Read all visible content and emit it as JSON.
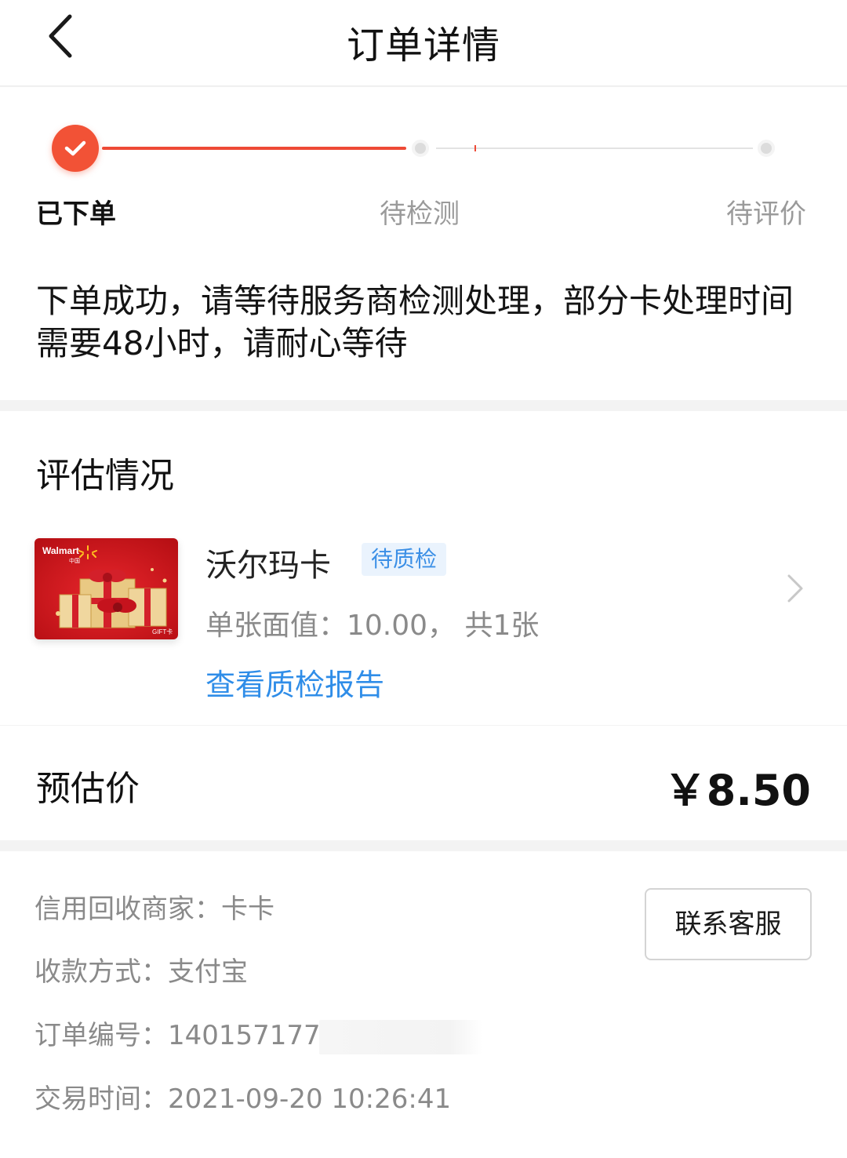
{
  "header": {
    "title": "订单详情",
    "back_icon": "chevron-left-icon"
  },
  "progress": {
    "current_step": 1,
    "steps": [
      {
        "label": "已下单",
        "state": "done"
      },
      {
        "label": "待检测",
        "state": "pending"
      },
      {
        "label": "待评价",
        "state": "pending"
      }
    ],
    "message": "下单成功，请等待服务商检测处理，部分卡处理时间需要48小时，请耐心等待"
  },
  "evaluation": {
    "title": "评估情况",
    "card": {
      "name": "沃尔玛卡",
      "status_badge": "待质检",
      "face_value_text": "单张面值：10.00， 共1张",
      "report_link": "查看质检报告",
      "image_brand_text": "Walmart",
      "image_region_text": "中国",
      "image_footer_text": "GIFT卡"
    }
  },
  "price": {
    "label": "预估价",
    "value": "￥8.50"
  },
  "info": {
    "merchant": "信用回收商家：卡卡",
    "payment": "收款方式：支付宝",
    "order_no": "订单编号：140157177",
    "time": "交易时间：2021-09-20 10:26:41",
    "contact_button": "联系客服"
  },
  "colors": {
    "accent": "#f25236",
    "link": "#2f8de8",
    "badge_bg": "#eaf3fd",
    "muted_text": "#8a8a8a"
  }
}
